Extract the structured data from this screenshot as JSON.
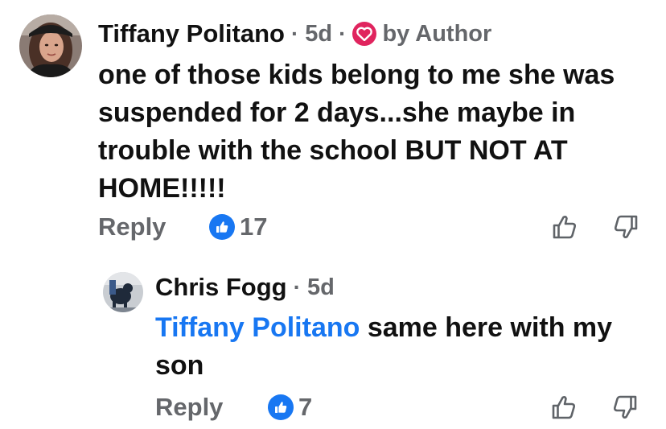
{
  "comment": {
    "author": "Tiffany Politano",
    "separator": "·",
    "time": "5d",
    "author_badge_label": "by Author",
    "text": "one of those kids belong to me she was suspended for 2 days...she maybe in trouble with the school BUT NOT AT HOME!!!!!",
    "reply_label": "Reply",
    "reaction_count": "17",
    "reaction_icon": "thumbs-up-icon",
    "upvote_icon": "thumb-up-outline-icon",
    "downvote_icon": "thumb-down-outline-icon"
  },
  "reply": {
    "author": "Chris Fogg",
    "separator": "·",
    "time": "5d",
    "mention": "Tiffany Politano",
    "text": " same here with my son",
    "reply_label": "Reply",
    "reaction_count": "7",
    "reaction_icon": "thumbs-up-icon",
    "upvote_icon": "thumb-up-outline-icon",
    "downvote_icon": "thumb-down-outline-icon"
  },
  "colors": {
    "text": "#111111",
    "secondary": "#65676b",
    "link_blue": "#1877f2",
    "author_heart": "#e0245e",
    "background": "#ffffff"
  }
}
